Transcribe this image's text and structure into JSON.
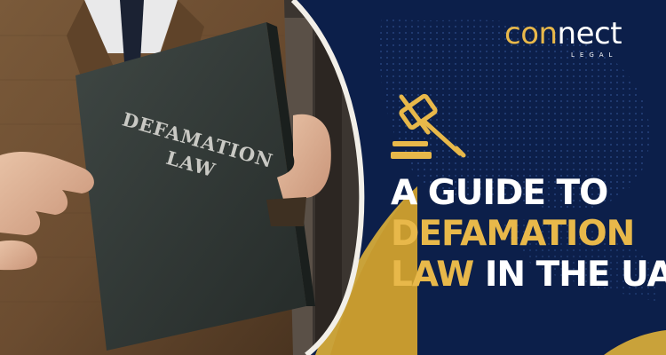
{
  "logo": {
    "part_a": "con",
    "part_b": "nect",
    "sub": "LEGAL"
  },
  "book": {
    "line1": "DEFAMATION",
    "line2": "LAW"
  },
  "headline": {
    "line1": "A GUIDE TO",
    "line2": "DEFAMATION",
    "line3_gold": "LAW",
    "line3_white": " IN THE UAE"
  },
  "colors": {
    "navy": "#0c1f4a",
    "gold": "#e8b84a",
    "white": "#ffffff"
  },
  "icons": [
    "gavel-icon"
  ]
}
